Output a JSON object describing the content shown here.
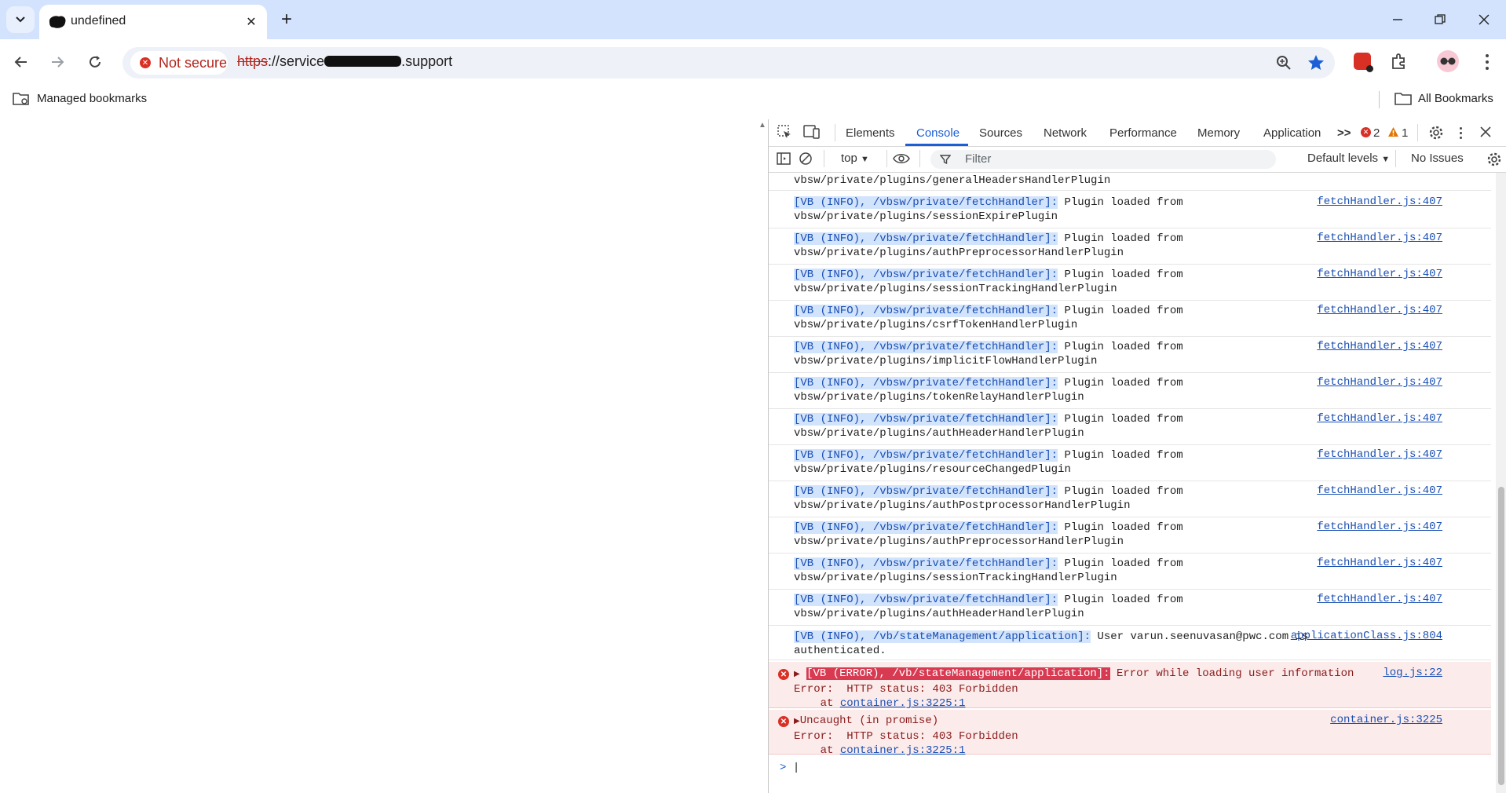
{
  "browser": {
    "tab_title": "undefined",
    "security_chip": "Not secure",
    "url_scheme": "https",
    "url_rest": "://service",
    "url_tld": ".support",
    "bookmarks_managed": "Managed bookmarks",
    "bookmarks_all": "All Bookmarks"
  },
  "devtools": {
    "tabs": [
      "Elements",
      "Console",
      "Sources",
      "Network",
      "Performance",
      "Memory",
      "Application"
    ],
    "overflow": ">>",
    "error_count": "2",
    "warning_count": "1",
    "context": "top",
    "filter_placeholder": "Filter",
    "levels": "Default levels",
    "issues": "No Issues"
  },
  "console": {
    "partial_row": "vbsw/private/plugins/generalHeadersHandlerPlugin",
    "info_badge": "[VB (INFO), /vbsw/private/fetchHandler]:",
    "info_text": " Plugin loaded from",
    "info_source": "fetchHandler.js:407",
    "plugin_paths": [
      "vbsw/private/plugins/sessionExpirePlugin",
      "vbsw/private/plugins/authPreprocessorHandlerPlugin",
      "vbsw/private/plugins/sessionTrackingHandlerPlugin",
      "vbsw/private/plugins/csrfTokenHandlerPlugin",
      "vbsw/private/plugins/implicitFlowHandlerPlugin",
      "vbsw/private/plugins/tokenRelayHandlerPlugin",
      "vbsw/private/plugins/authHeaderHandlerPlugin",
      "vbsw/private/plugins/resourceChangedPlugin",
      "vbsw/private/plugins/authPostprocessorHandlerPlugin",
      "vbsw/private/plugins/authPreprocessorHandlerPlugin",
      "vbsw/private/plugins/sessionTrackingHandlerPlugin",
      "vbsw/private/plugins/authHeaderHandlerPlugin"
    ],
    "auth_badge": "[VB (INFO), /vb/stateManagement/application]:",
    "auth_text": " User varun.seenuvasan@pwc.com is",
    "auth_text2": "authenticated.",
    "auth_source": "applicationClass.js:804",
    "error1_badge": "[VB (ERROR), /vb/stateManagement/application]:",
    "error1_text": " Error while loading user information",
    "error1_source": "log.js:22",
    "error_line2": "Error:  HTTP status: 403 Forbidden",
    "error_at": "    at ",
    "error_link": "container.js:3225:1",
    "error2_text": "Uncaught (in promise)",
    "error2_source": "container.js:3225",
    "prompt": ">"
  }
}
